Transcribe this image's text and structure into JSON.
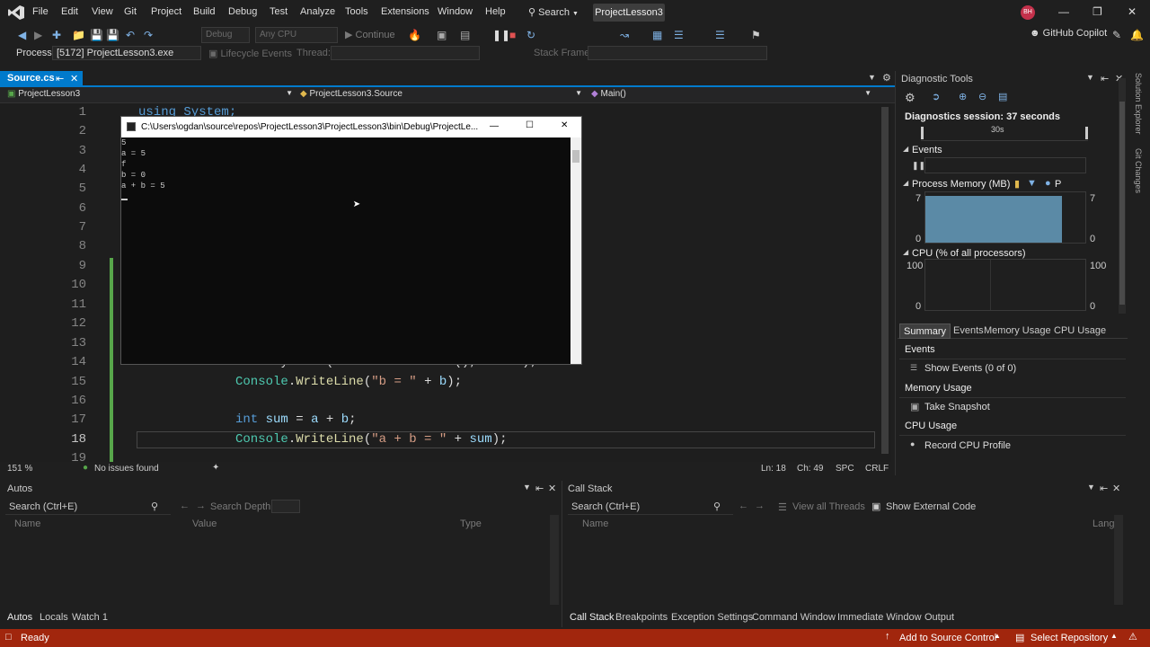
{
  "menubar": {
    "items": [
      "File",
      "Edit",
      "View",
      "Git",
      "Project",
      "Build",
      "Debug",
      "Test",
      "Analyze",
      "Tools",
      "Extensions",
      "Window",
      "Help"
    ],
    "search_label": "Search",
    "project_tab": "ProjectLesson3",
    "avatar_initials": "BH"
  },
  "toolbar": {
    "config_combo": "Debug",
    "platform_combo": "Any CPU",
    "continue_label": "Continue",
    "copilot_label": "GitHub Copilot"
  },
  "toolbar2": {
    "process_label": "Process:",
    "process_value": "[5172] ProjectLesson3.exe",
    "lifecycle_label": "Lifecycle Events",
    "thread_label": "Thread:",
    "stack_frame_label": "Stack Frame:"
  },
  "editor": {
    "tab_label": "Source.cs",
    "nav_project": "ProjectLesson3",
    "nav_class": "ProjectLesson3.Source",
    "nav_member": "Main()",
    "line_numbers": [
      "1",
      "2",
      "3",
      "4",
      "5",
      "6",
      "7",
      "8",
      "9",
      "10",
      "11",
      "12",
      "13",
      "14",
      "15",
      "16",
      "17",
      "18",
      "19"
    ],
    "line1_code": "using System;",
    "line14_code": "int.TryParse(Console.ReadLine(), out b);",
    "zoom": "151 %",
    "issues": "No issues found",
    "position_ln": "Ln: 18",
    "position_ch": "Ch: 49",
    "encoding_spc": "SPC",
    "line_ending": "CRLF"
  },
  "console": {
    "title": "C:\\Users\\ogdan\\source\\repos\\ProjectLesson3\\ProjectLesson3\\bin\\Debug\\ProjectLe...",
    "lines": [
      "5",
      "a = 5",
      "f",
      "b = 0",
      "a + b = 5"
    ]
  },
  "diagnostics": {
    "title": "Diagnostic Tools",
    "session": "Diagnostics session: 37 seconds",
    "timeline_label": "30s",
    "events_header": "Events",
    "process_memory_header": "Process Memory (MB)",
    "memory_legend_p": "P",
    "mem_max_left": "7",
    "mem_max_right": "7",
    "mem_min_left": "0",
    "mem_min_right": "0",
    "cpu_header": "CPU (% of all processors)",
    "cpu_max_left": "100",
    "cpu_max_right": "100",
    "cpu_min_left": "0",
    "cpu_min_right": "0",
    "tabs": [
      "Summary",
      "Events",
      "Memory Usage",
      "CPU Usage"
    ],
    "summary_events_header": "Events",
    "show_events": "Show Events (0 of 0)",
    "memory_usage_header": "Memory Usage",
    "take_snapshot": "Take Snapshot",
    "cpu_usage_header": "CPU Usage",
    "record_cpu": "Record CPU Profile"
  },
  "autos": {
    "title": "Autos",
    "search_placeholder": "Search (Ctrl+E)",
    "search_depth_label": "Search Depth:",
    "col_name": "Name",
    "col_value": "Value",
    "col_type": "Type",
    "tabs": [
      "Autos",
      "Locals",
      "Watch 1"
    ]
  },
  "callstack": {
    "title": "Call Stack",
    "search_placeholder": "Search (Ctrl+E)",
    "view_all_threads": "View all Threads",
    "show_external_code": "Show External Code",
    "col_name": "Name",
    "col_lang": "Lang",
    "tabs": [
      "Call Stack",
      "Breakpoints",
      "Exception Settings",
      "Command Window",
      "Immediate Window",
      "Output"
    ]
  },
  "statusbar": {
    "ready": "Ready",
    "add_source_control": "Add to Source Control",
    "select_repository": "Select Repository"
  },
  "colors": {
    "accent": "#007acc",
    "statusbar": "#a1260d",
    "memory_fill": "#5b8aa6",
    "change_marker": "#57a64a"
  }
}
